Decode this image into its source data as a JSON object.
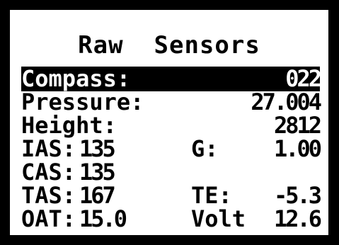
{
  "screen": {
    "title": "Raw  Sensors"
  },
  "rows": {
    "compass": {
      "label": "Compass:",
      "value": "022"
    },
    "pressure": {
      "label": "Pressure:",
      "value": "27.004"
    },
    "height": {
      "label": "Height:",
      "value": "2812"
    },
    "ias": {
      "label": "IAS:",
      "value": "135"
    },
    "g": {
      "label": "G:",
      "value": "1.00"
    },
    "cas": {
      "label": "CAS:",
      "value": "135"
    },
    "tas": {
      "label": "TAS:",
      "value": "167"
    },
    "te": {
      "label": "TE:",
      "value": "-5.3"
    },
    "oat": {
      "label": "OAT:",
      "value": "15.0"
    },
    "volt": {
      "label": "Volt",
      "value": "12.6"
    }
  },
  "colors": {
    "background": "#000000",
    "screen": "#ffffff",
    "text": "#000000",
    "selected_bg": "#000000",
    "selected_text": "#ffffff"
  }
}
